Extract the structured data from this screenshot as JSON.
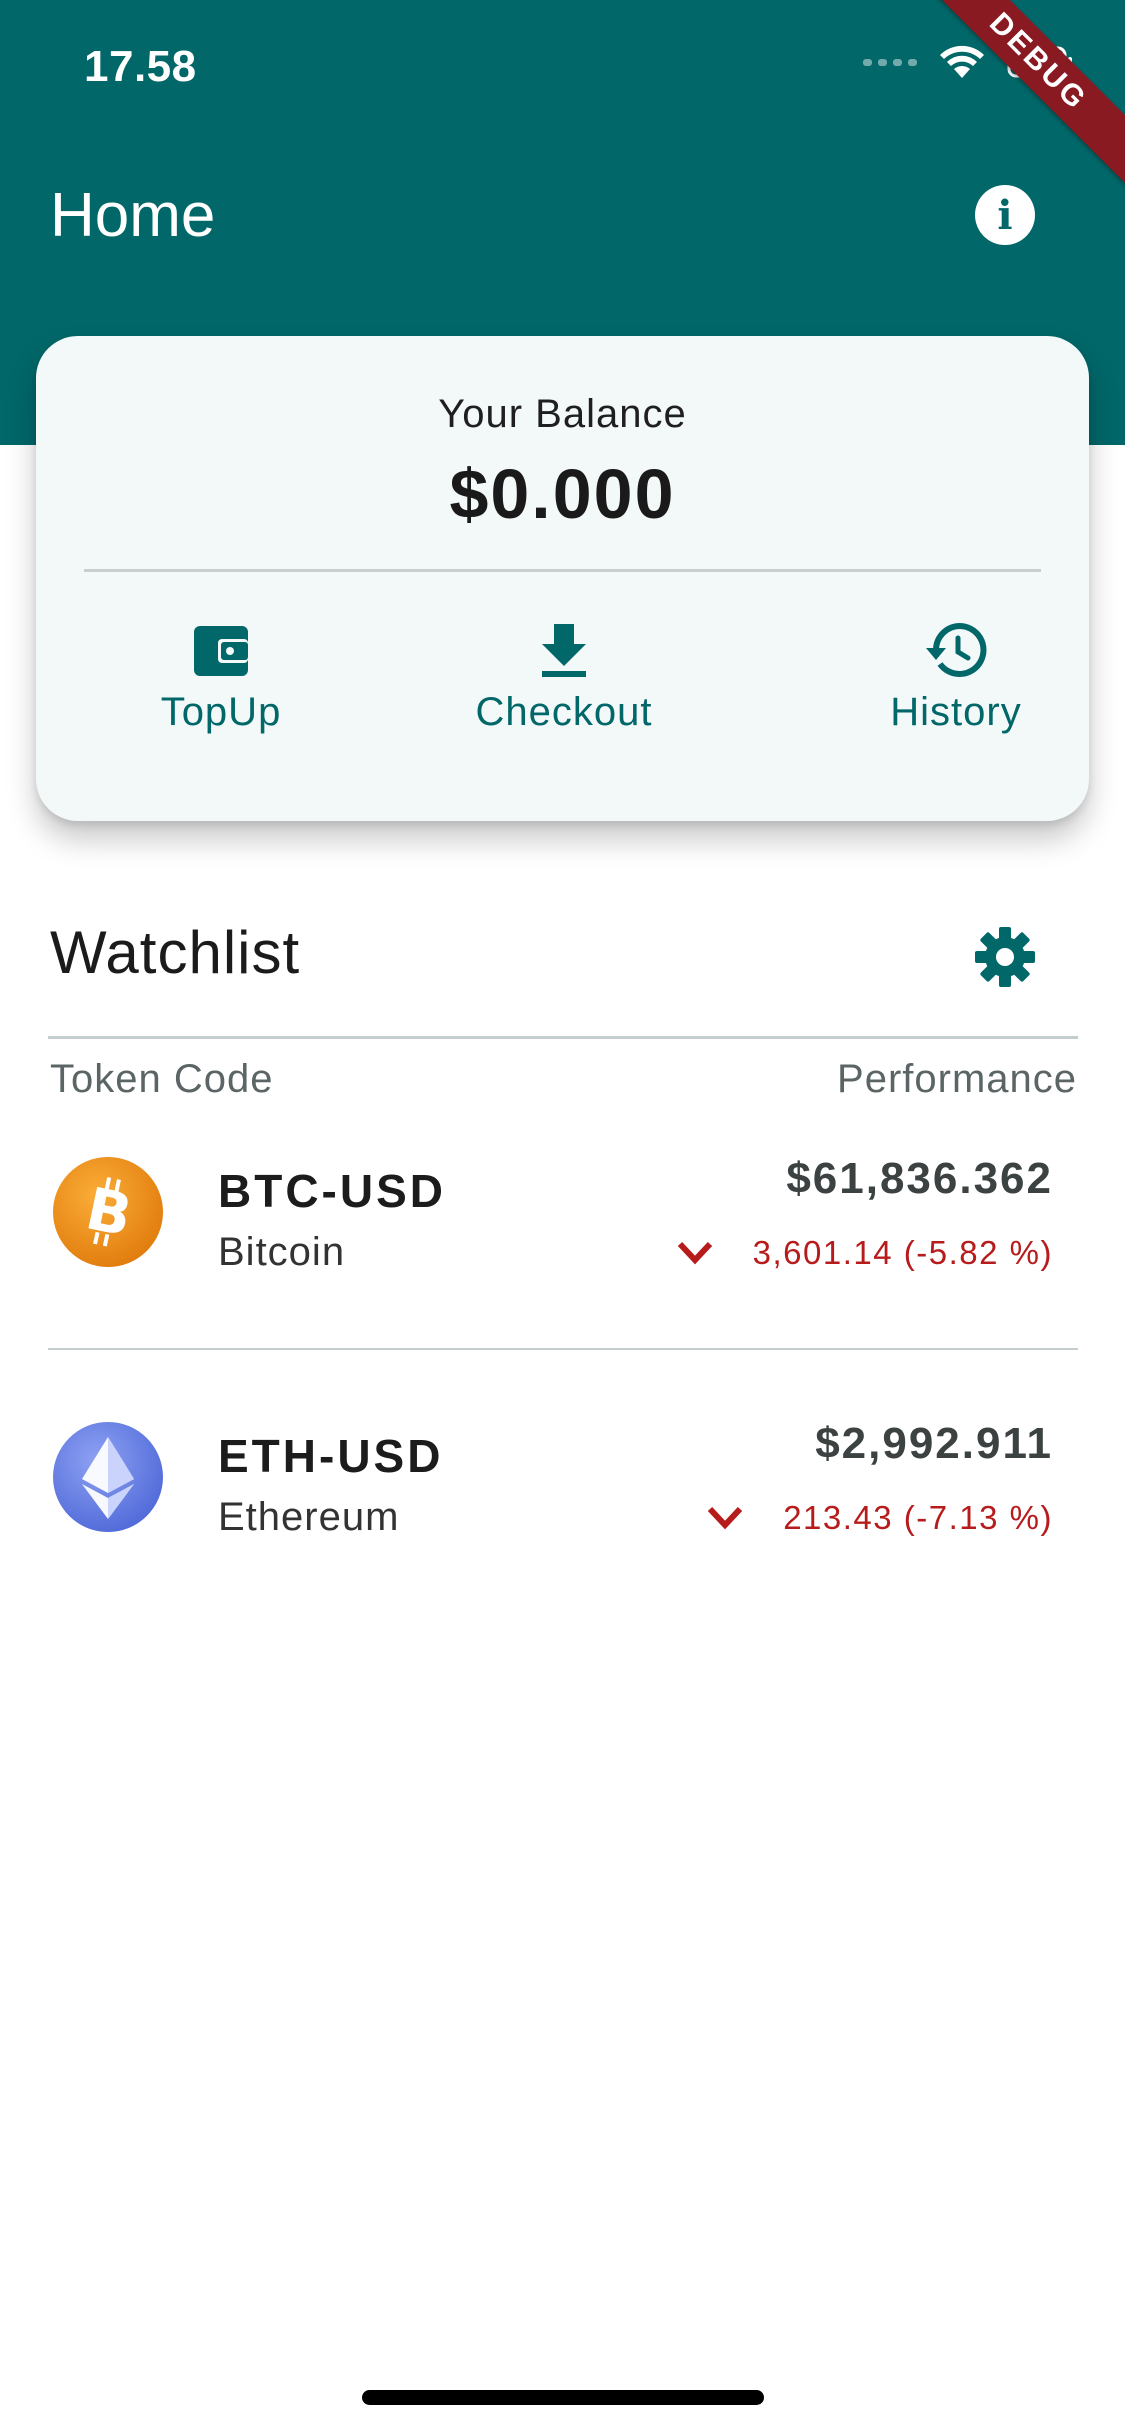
{
  "status_bar": {
    "time": "17.58"
  },
  "debug_banner": "DEBUG",
  "app_bar": {
    "title": "Home",
    "info_icon": "info-icon"
  },
  "balance_card": {
    "label": "Your Balance",
    "amount": "$0.000",
    "actions": [
      {
        "label": "TopUp",
        "icon": "wallet-icon"
      },
      {
        "label": "Checkout",
        "icon": "download-icon"
      },
      {
        "label": "History",
        "icon": "history-icon"
      }
    ]
  },
  "watchlist": {
    "title": "Watchlist",
    "settings_icon": "gear-icon",
    "columns": {
      "left": "Token Code",
      "right": "Performance"
    },
    "tokens": [
      {
        "code": "BTC-USD",
        "name": "Bitcoin",
        "price": "$61,836.362",
        "change": "3,601.14 (-5.82 %)",
        "trend_icon": "chevron-down-icon",
        "coin_color": "#F7931A"
      },
      {
        "code": "ETH-USD",
        "name": "Ethereum",
        "price": "$2,992.911",
        "change": "213.43 (-7.13 %)",
        "trend_icon": "chevron-down-icon",
        "coin_color": "#627EEA"
      }
    ]
  },
  "colors": {
    "primary": "#016769",
    "negative": "#B71C1C",
    "card_bg": "#F3F9F9"
  }
}
